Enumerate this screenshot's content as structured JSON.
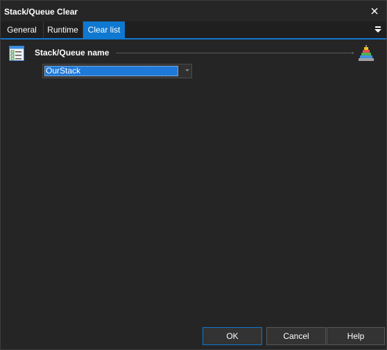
{
  "window": {
    "title": "Stack/Queue Clear"
  },
  "tabs": [
    {
      "label": "General"
    },
    {
      "label": "Runtime"
    },
    {
      "label": "Clear list"
    }
  ],
  "section": {
    "label": "Stack/Queue name"
  },
  "stack_name": {
    "value": "OurStack"
  },
  "buttons": {
    "ok": "OK",
    "cancel": "Cancel",
    "help": "Help"
  },
  "icons": {
    "close": "close-icon",
    "tab_menu": "menu-icon",
    "section": "list-check-icon",
    "variables": "pyramid-icon"
  },
  "colors": {
    "accent": "#0f78d0",
    "background": "#252525",
    "selection": "#1e79d9"
  }
}
